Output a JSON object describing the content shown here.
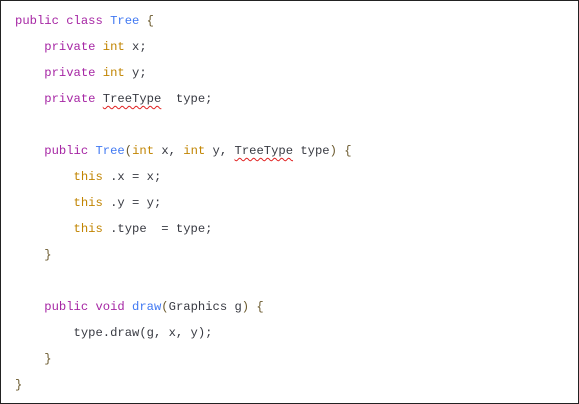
{
  "code": {
    "lines": [
      [
        [
          "kw",
          "public class "
        ],
        [
          "fn",
          "Tree"
        ],
        [
          "pn",
          " {"
        ]
      ],
      [
        [
          "tx",
          "    "
        ],
        [
          "kw",
          "private "
        ],
        [
          "ty",
          "int "
        ],
        [
          "tx",
          "x;"
        ]
      ],
      [
        [
          "tx",
          "    "
        ],
        [
          "kw",
          "private "
        ],
        [
          "ty",
          "int "
        ],
        [
          "tx",
          "y;"
        ]
      ],
      [
        [
          "tx",
          "    "
        ],
        [
          "kw",
          "private "
        ],
        [
          "sp",
          "TreeType"
        ],
        [
          "tx",
          "  type;"
        ]
      ],
      [],
      [
        [
          "tx",
          "    "
        ],
        [
          "kw",
          "public "
        ],
        [
          "fn",
          "Tree"
        ],
        [
          "pn",
          "("
        ],
        [
          "ty",
          "int "
        ],
        [
          "tx",
          "x, "
        ],
        [
          "ty",
          "int "
        ],
        [
          "tx",
          "y, "
        ],
        [
          "sp",
          "TreeType"
        ],
        [
          "tx",
          " type"
        ],
        [
          "pn",
          ") {"
        ]
      ],
      [
        [
          "tx",
          "        "
        ],
        [
          "ty",
          "this"
        ],
        [
          "tx",
          " .x = x;"
        ]
      ],
      [
        [
          "tx",
          "        "
        ],
        [
          "ty",
          "this"
        ],
        [
          "tx",
          " .y = y;"
        ]
      ],
      [
        [
          "tx",
          "        "
        ],
        [
          "ty",
          "this"
        ],
        [
          "tx",
          " .type  = type;"
        ]
      ],
      [
        [
          "tx",
          "    "
        ],
        [
          "pn",
          "}"
        ]
      ],
      [],
      [
        [
          "tx",
          "    "
        ],
        [
          "kw",
          "public void "
        ],
        [
          "fn",
          "draw"
        ],
        [
          "pn",
          "("
        ],
        [
          "tx",
          "Graphics g"
        ],
        [
          "pn",
          ") {"
        ]
      ],
      [
        [
          "tx",
          "        type.draw(g, x, y);"
        ]
      ],
      [
        [
          "tx",
          "    "
        ],
        [
          "pn",
          "}"
        ]
      ],
      [
        [
          "pn",
          "}"
        ]
      ]
    ]
  }
}
